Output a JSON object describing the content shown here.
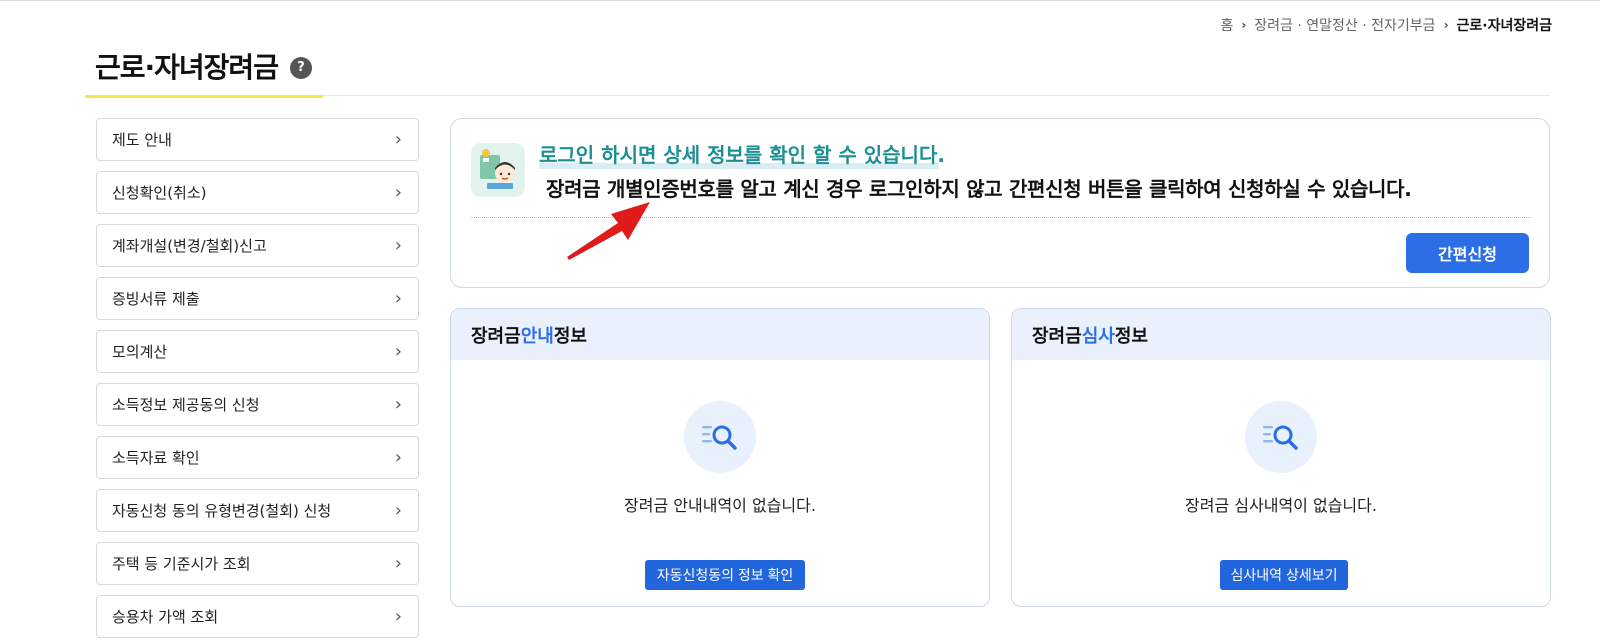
{
  "breadcrumb": {
    "home": "홈",
    "level2": "장려금 · 연말정산 · 전자기부금",
    "current": "근로·자녀장려금"
  },
  "page": {
    "title": "근로·자녀장려금",
    "help_glyph": "?"
  },
  "sidebar": {
    "chevron": "›",
    "items": [
      {
        "label": "제도 안내"
      },
      {
        "label": "신청확인(취소)"
      },
      {
        "label": "계좌개설(변경/철회)신고"
      },
      {
        "label": "증빙서류 제출"
      },
      {
        "label": "모의계산"
      },
      {
        "label": "소득정보 제공동의 신청"
      },
      {
        "label": "소득자료 확인"
      },
      {
        "label": "자동신청 동의 유형변경(철회) 신청"
      },
      {
        "label": "주택 등 기준시가 조회"
      },
      {
        "label": "승용차 가액 조회"
      }
    ]
  },
  "login_notice": {
    "headline": "로그인 하시면 상세 정보를 확인 할 수 있습니다.",
    "description": "장려금 개별인증번호를 알고 계신 경우 로그인하지 않고 간편신청 버튼을 클릭하여 신청하실 수 있습니다.",
    "button_label": "간편신청",
    "illustration_icon": "person-laptop-icon",
    "annotation_icon": "red-arrow-icon"
  },
  "guide_card": {
    "title_prefix": "장려금 ",
    "title_accent": "안내",
    "title_suffix": " 정보",
    "icon": "document-search-icon",
    "empty_text": "장려금 안내내역이 없습니다.",
    "button_label": "자동신청동의 정보 확인"
  },
  "review_card": {
    "title_prefix": "장려금 ",
    "title_accent": "심사",
    "title_suffix": " 정보",
    "icon": "document-search-icon",
    "empty_text": "장려금 심사내역이 없습니다.",
    "button_label": "심사내역 상세보기"
  },
  "colors": {
    "accent_blue": "#2b6ee6",
    "headline_teal": "#1c8f93",
    "title_highlight_yellow": "#f2e84a",
    "arrow_red": "#e01b1b",
    "card_header_bg": "#eaf1fd"
  }
}
